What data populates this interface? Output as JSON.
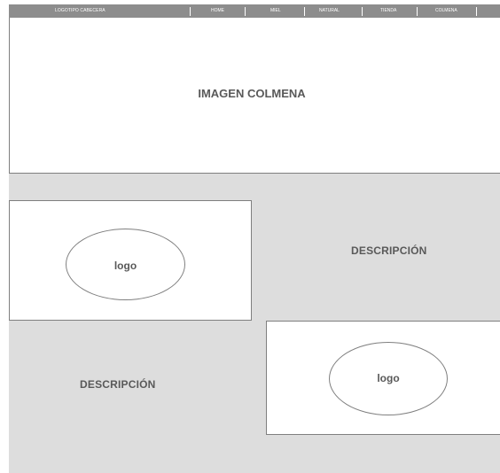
{
  "navbar": {
    "logo_text": "LOGOTIPO CABECERA",
    "items": [
      {
        "label": "HOME"
      },
      {
        "label": "MIEL"
      },
      {
        "label": "NATURAL"
      },
      {
        "label": "TIENDA"
      },
      {
        "label": "COLMENA"
      }
    ]
  },
  "hero": {
    "title": "IMAGEN COLMENA"
  },
  "sections": [
    {
      "logo_label": "logo",
      "description": "DESCRIPCIÓN"
    },
    {
      "logo_label": "logo",
      "description": "DESCRIPCIÓN"
    }
  ],
  "colors": {
    "navbar_bg": "#8d8d8d",
    "content_bg": "#dddddd",
    "text": "#595959",
    "border": "#7f7f7f"
  }
}
